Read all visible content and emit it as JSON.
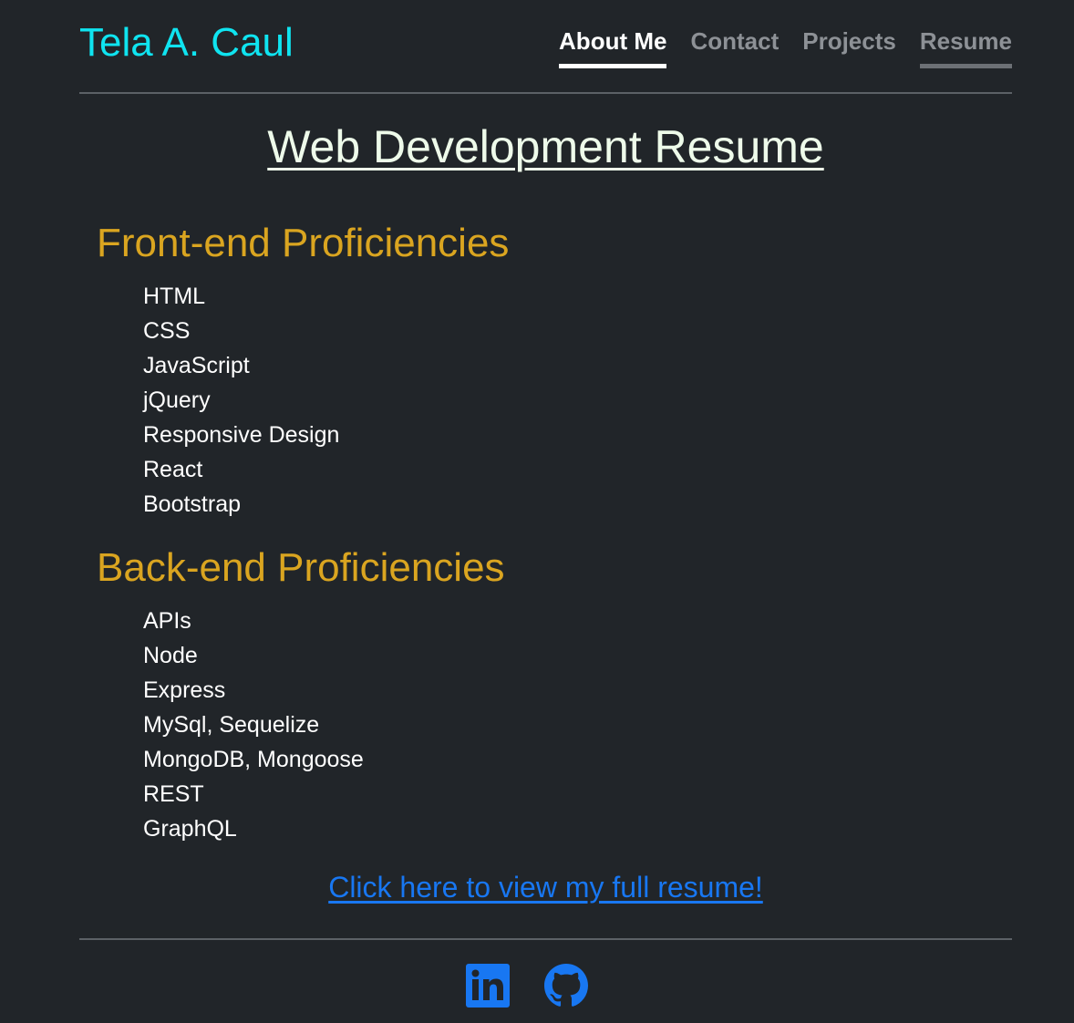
{
  "header": {
    "brand": "Tela A. Caul",
    "nav": [
      {
        "label": "About Me",
        "state": "active"
      },
      {
        "label": "Contact",
        "state": "default"
      },
      {
        "label": "Projects",
        "state": "default"
      },
      {
        "label": "Resume",
        "state": "visited"
      }
    ]
  },
  "main": {
    "title": "Web Development Resume",
    "front_end": {
      "heading": "Front-end Proficiencies",
      "items": [
        "HTML",
        "CSS",
        "JavaScript",
        "jQuery",
        "Responsive Design",
        "React",
        "Bootstrap"
      ]
    },
    "back_end": {
      "heading": "Back-end Proficiencies",
      "items": [
        "APIs",
        "Node",
        "Express",
        "MySql, Sequelize",
        "MongoDB, Mongoose",
        "REST",
        "GraphQL"
      ]
    },
    "resume_link": "Click here to view my full resume!"
  },
  "footer": {
    "icons": [
      "linkedin-icon",
      "github-icon"
    ]
  },
  "colors": {
    "background": "#212529",
    "brand": "#0fe4f0",
    "heading": "#daa520",
    "title": "#eefbea",
    "link": "#1877f2",
    "icon": "#1877f2"
  }
}
